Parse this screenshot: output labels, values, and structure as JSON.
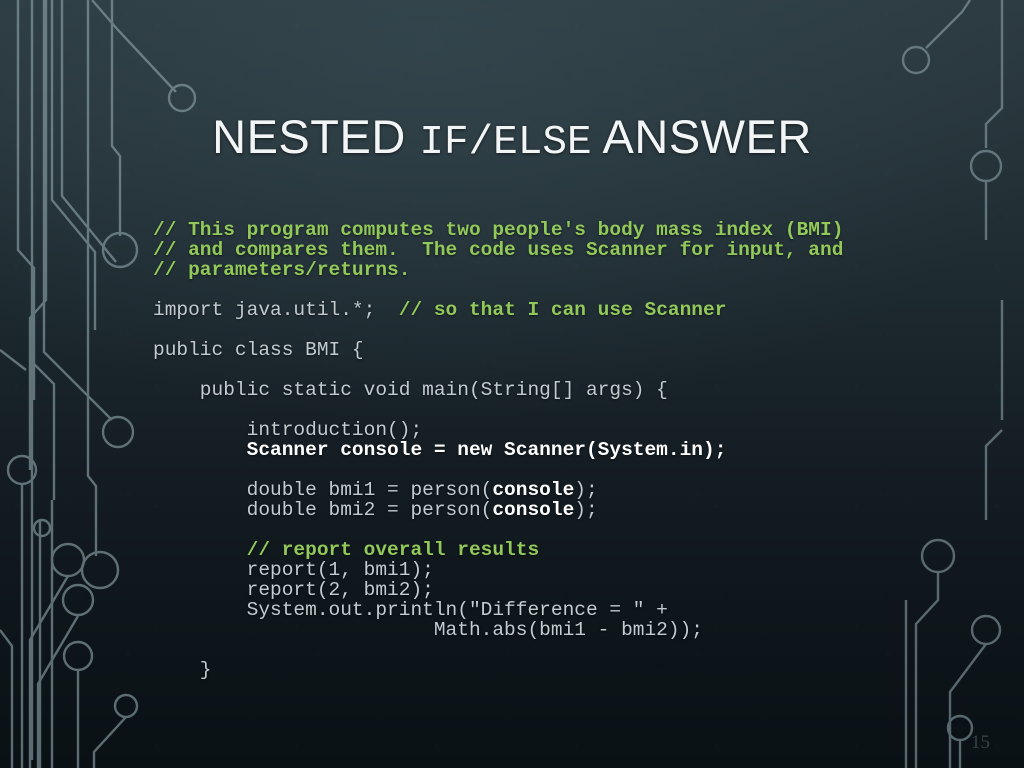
{
  "slide": {
    "title_plain_1": "NESTED ",
    "title_mono": "IF/ELSE",
    "title_plain_2": " ANSWER",
    "page_number": "15",
    "colors": {
      "background_top": "#2c3b41",
      "background_bottom": "#0a1115",
      "comment_green": "#92c85a",
      "code_gray": "#c2cbcf",
      "code_bold_white": "#ffffff",
      "trace_line": "#8fa5ab",
      "title_white": "#f2f5f6"
    }
  },
  "code": {
    "lines": [
      {
        "id": "l1",
        "segments": [
          {
            "text": "// This program computes two people's body mass index (BMI)",
            "style": "comment"
          }
        ]
      },
      {
        "id": "l2",
        "segments": [
          {
            "text": "// and compares them.  The code uses Scanner for input, and",
            "style": "comment"
          }
        ]
      },
      {
        "id": "l3",
        "segments": [
          {
            "text": "// parameters/returns.",
            "style": "comment"
          }
        ]
      },
      {
        "id": "l4",
        "segments": []
      },
      {
        "id": "l5",
        "segments": [
          {
            "text": "import java.util.*;  ",
            "style": "plain"
          },
          {
            "text": "// so that I can use Scanner",
            "style": "comment"
          }
        ]
      },
      {
        "id": "l6",
        "segments": []
      },
      {
        "id": "l7",
        "segments": [
          {
            "text": "public class BMI {",
            "style": "plain"
          }
        ]
      },
      {
        "id": "l8",
        "segments": []
      },
      {
        "id": "l9",
        "segments": [
          {
            "text": "    public static void main(String[] args) {",
            "style": "plain"
          }
        ]
      },
      {
        "id": "l10",
        "segments": []
      },
      {
        "id": "l11",
        "segments": [
          {
            "text": "        introduction();",
            "style": "plain"
          }
        ]
      },
      {
        "id": "l12",
        "segments": [
          {
            "text": "        Scanner console = new Scanner(System.in);",
            "style": "bold"
          }
        ]
      },
      {
        "id": "l13",
        "segments": []
      },
      {
        "id": "l14",
        "segments": [
          {
            "text": "        double bmi1 = person(",
            "style": "plain"
          },
          {
            "text": "console",
            "style": "bold"
          },
          {
            "text": ");",
            "style": "plain"
          }
        ]
      },
      {
        "id": "l15",
        "segments": [
          {
            "text": "        double bmi2 = person(",
            "style": "plain"
          },
          {
            "text": "console",
            "style": "bold"
          },
          {
            "text": ");",
            "style": "plain"
          }
        ]
      },
      {
        "id": "l16",
        "segments": []
      },
      {
        "id": "l17",
        "segments": [
          {
            "text": "        // report overall results",
            "style": "comment"
          }
        ]
      },
      {
        "id": "l18",
        "segments": [
          {
            "text": "        report(1, bmi1);",
            "style": "plain"
          }
        ]
      },
      {
        "id": "l19",
        "segments": [
          {
            "text": "        report(2, bmi2);",
            "style": "plain"
          }
        ]
      },
      {
        "id": "l20",
        "segments": [
          {
            "text": "        System.out.println(\"Difference = \" +",
            "style": "plain"
          }
        ]
      },
      {
        "id": "l21",
        "segments": [
          {
            "text": "                        Math.abs(bmi1 - bmi2));",
            "style": "plain"
          }
        ]
      },
      {
        "id": "l22",
        "segments": []
      },
      {
        "id": "l23",
        "segments": [
          {
            "text": "    }",
            "style": "plain"
          }
        ]
      }
    ]
  }
}
